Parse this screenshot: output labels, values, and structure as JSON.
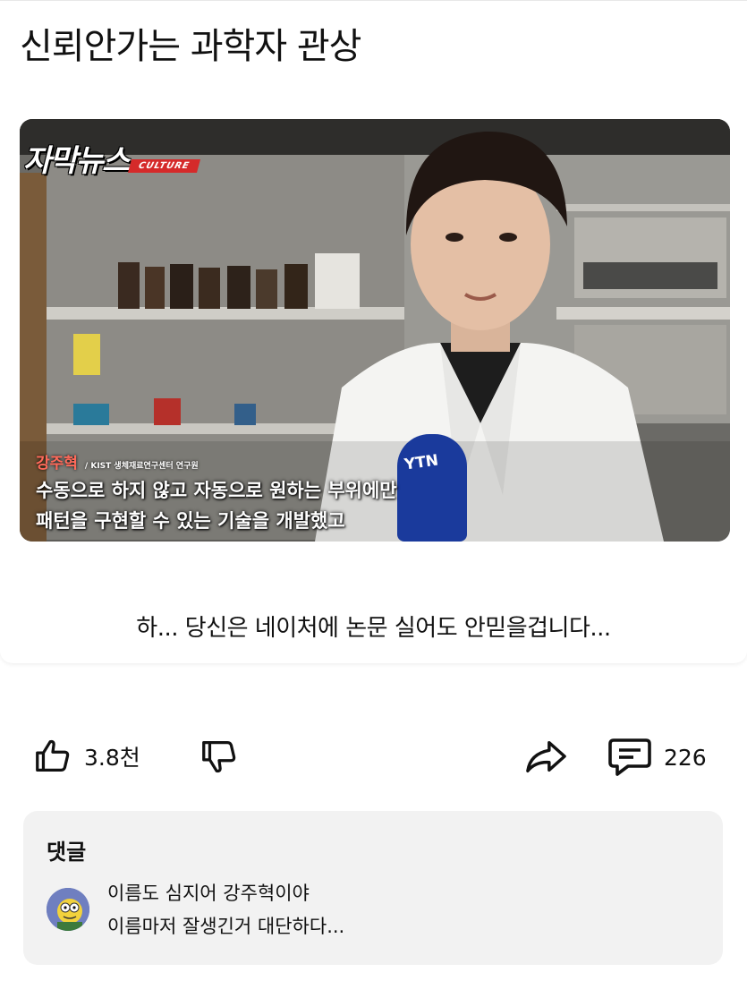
{
  "post": {
    "title": "신뢰안가는 과학자 관상",
    "caption": "하... 당신은 네이처에 논문 실어도 안믿을겁니다...",
    "video": {
      "logo_text": "자막뉴스",
      "logo_tag": "CULTURE",
      "mic_label": "YTN",
      "speaker_name": "강주혁",
      "speaker_affiliation": "/ KIST 생체재료연구센터 연구원",
      "subtitle_lines": [
        "수동으로 하지 않고 자동으로 원하는 부위에만",
        "패턴을 구현할 수 있는 기술을 개발했고"
      ]
    }
  },
  "actions": {
    "like_count": "3.8천",
    "comment_count": "226",
    "icons": {
      "like": "thumbs-up-icon",
      "dislike": "thumbs-down-icon",
      "share": "share-arrow-icon",
      "comment": "comment-bubble-icon"
    }
  },
  "comments": {
    "header": "댓글",
    "top_comment": {
      "lines": [
        "이름도 심지어 강주혁이야",
        "이름마저 잘생긴거 대단하다..."
      ]
    }
  }
}
